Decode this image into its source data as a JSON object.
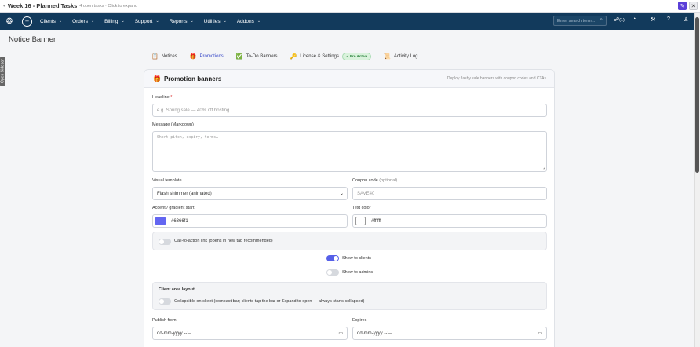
{
  "taskbar": {
    "title": "Week 16 - Planned Tasks",
    "subtitle": "4 open tasks · Click to expand"
  },
  "nav": {
    "menu": [
      "Clients",
      "Orders",
      "Billing",
      "Support",
      "Reports",
      "Utilities",
      "Addons"
    ],
    "search_placeholder": "Enter search term...",
    "notifications": "(1)"
  },
  "sidebar_tab": "Open Sidebar",
  "page_title": "Notice Banner",
  "tabs": [
    {
      "label": "Notices",
      "icon": "📋"
    },
    {
      "label": "Promotions",
      "icon": "🎁"
    },
    {
      "label": "To-Do Banners",
      "icon": "✅"
    },
    {
      "label": "License & Settings",
      "icon": "🔑",
      "badge": "✓ Pro Active"
    },
    {
      "label": "Activity Log",
      "icon": "📜"
    }
  ],
  "card": {
    "title": "Promotion banners",
    "description": "Deploy flashy sale banners with coupon codes and CTAs"
  },
  "form": {
    "headline_label": "Headline",
    "headline_required": "*",
    "headline_placeholder": "e.g. Spring sale — 40% off hosting",
    "message_label": "Message (Markdown)",
    "message_placeholder": "Short pitch, expiry, terms…",
    "template_label": "Visual template",
    "template_value": "Flash shimmer (animated)",
    "coupon_label": "Coupon code",
    "coupon_optional": "(optional)",
    "coupon_placeholder": "SAVE40",
    "accent_label": "Accent / gradient start",
    "accent_value": "#6366f1",
    "text_color_label": "Text color",
    "text_color_value": "#ffffff",
    "cta_label": "Call-to-action link (opens in new tab recommended)",
    "show_clients_label": "Show to clients",
    "show_admins_label": "Show to admins",
    "client_layout_title": "Client area layout",
    "collapsible_label": "Collapsible on client (compact bar; clients tap the bar or Expand to open — always starts collapsed)",
    "publish_label": "Publish from",
    "publish_placeholder": "dd-mm-yyyy --:--",
    "expires_label": "Expires",
    "expires_placeholder": "dd-mm-yyyy --:--"
  },
  "toggles": {
    "cta": false,
    "show_clients": true,
    "show_admins": false,
    "collapsible": false
  },
  "colors": {
    "nav": "#123a5c",
    "accent": "#6366f1",
    "text": "#ffffff",
    "active_tab": "#3b4bc8"
  }
}
